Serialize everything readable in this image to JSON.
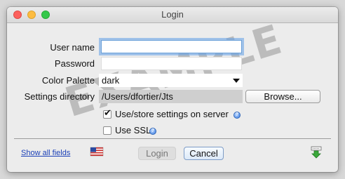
{
  "window": {
    "title": "Login"
  },
  "watermark": "EXAMPLE",
  "form": {
    "username_label": "User name",
    "username_value": "",
    "password_label": "Password",
    "password_value": "",
    "palette_label": "Color Palette",
    "palette_value": "dark",
    "settings_dir_label": "Settings directory",
    "settings_dir_value": "/Users/dfortier/Jts",
    "browse_label": "Browse..."
  },
  "options": {
    "use_store_settings": {
      "label": "Use/store settings on server",
      "checked": true
    },
    "use_ssl": {
      "label": "Use SSL",
      "checked": false
    }
  },
  "footer": {
    "show_all_fields": "Show all fields",
    "login_label": "Login",
    "cancel_label": "Cancel"
  },
  "icons": {
    "flag": "us-flag-icon",
    "download": "download-arrow-icon",
    "help": "help-icon"
  }
}
